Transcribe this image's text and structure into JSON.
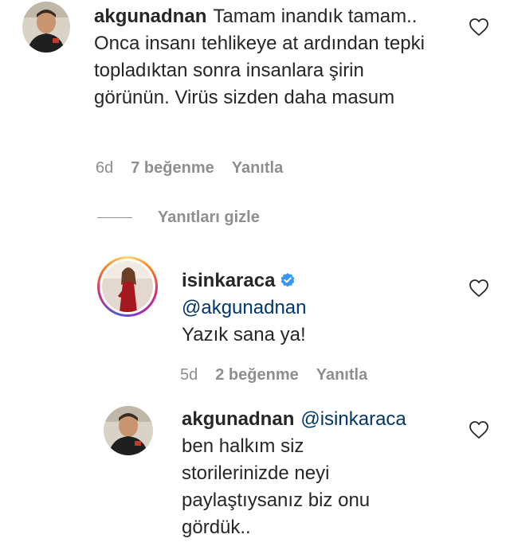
{
  "comment": {
    "username": "akgunadnan",
    "text": "Tamam inandık tamam.. Onca insanı tehlikeye at ardından tepki topladıktan sonra insanlara şirin görünün. Virüs sizden daha masum",
    "time": "6d",
    "likes": "7 beğenme",
    "reply": "Yanıtla"
  },
  "replies_toggle": {
    "label": "Yanıtları gizle"
  },
  "reply1": {
    "username": "isinkaraca",
    "mention": "@akgunadnan",
    "text": "Yazık sana ya!",
    "time": "5d",
    "likes": "2 beğenme",
    "reply": "Yanıtla",
    "verified_color": "#3897f0"
  },
  "reply2": {
    "username": "akgunadnan",
    "mention": "@isinkaraca",
    "text": "ben halkım siz storilerinizde neyi paylaştıysanız biz onu gördük.."
  },
  "icons": {
    "like": "heart-outline-icon",
    "verified": "verified-badge-icon"
  }
}
